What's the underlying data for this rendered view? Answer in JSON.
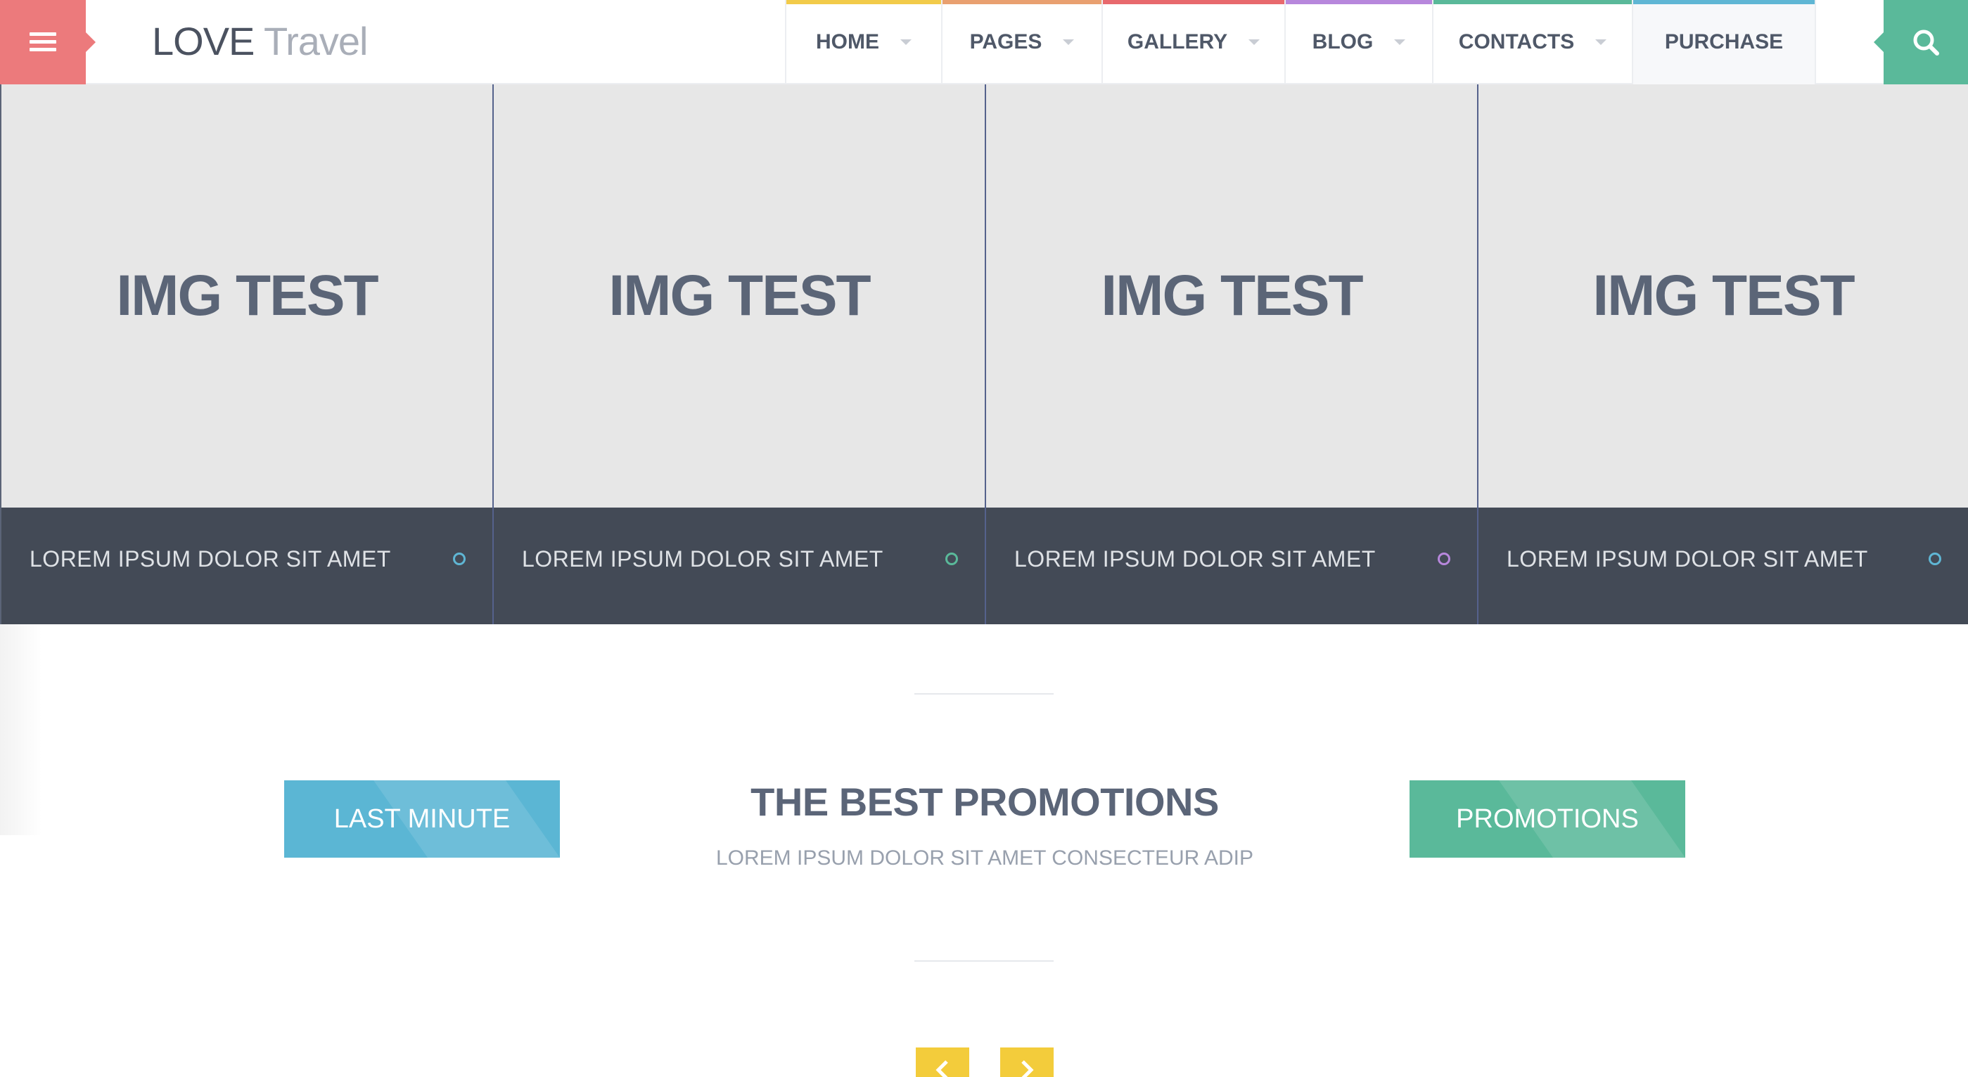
{
  "header": {
    "logo_main": "LOVE",
    "logo_sub": "Travel",
    "nav": [
      {
        "label": "HOME",
        "accent": "#f2cb4a",
        "has_caret": true
      },
      {
        "label": "PAGES",
        "accent": "#e9a070",
        "has_caret": true
      },
      {
        "label": "GALLERY",
        "accent": "#e8696d",
        "has_caret": true
      },
      {
        "label": "BLOG",
        "accent": "#b787dc",
        "has_caret": true
      },
      {
        "label": "CONTACTS",
        "accent": "#5ab99a",
        "has_caret": true
      },
      {
        "label": "PURCHASE",
        "accent": "#5fb6d4",
        "has_caret": false
      }
    ],
    "menu_icon": "hamburger-icon",
    "search_icon": "search-icon",
    "menu_color": "#ec7a7c",
    "search_color": "#5ab99a"
  },
  "slides": [
    {
      "image_text": "IMG TEST",
      "caption": "LOREM IPSUM DOLOR SIT AMET",
      "dot_color": "#5fb6d4"
    },
    {
      "image_text": "IMG TEST",
      "caption": "LOREM IPSUM DOLOR SIT AMET",
      "dot_color": "#5ab99a"
    },
    {
      "image_text": "IMG TEST",
      "caption": "LOREM IPSUM DOLOR SIT AMET",
      "dot_color": "#b787dc"
    },
    {
      "image_text": "IMG TEST",
      "caption": "LOREM IPSUM DOLOR SIT AMET",
      "dot_color": "#5fb6d4"
    }
  ],
  "promo": {
    "left_button": "LAST MINUTE",
    "left_color": "#5bb6d4",
    "title": "THE BEST PROMOTIONS",
    "subtitle": "LOREM IPSUM DOLOR SIT AMET CONSECTEUR ADIP",
    "right_button": "PROMOTIONS",
    "right_color": "#5ab99a",
    "prev_icon": "chevron-left-icon",
    "next_icon": "chevron-right-icon",
    "arrow_color": "#f3cc3b"
  }
}
